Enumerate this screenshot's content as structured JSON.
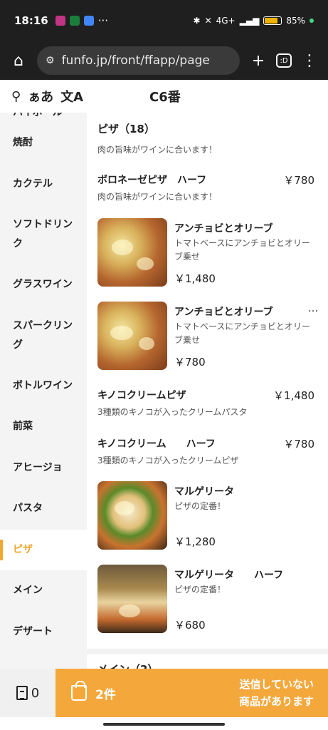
{
  "status_bar": {
    "time": "18:16",
    "network": "4G+",
    "battery": "85",
    "battery_fraction": 0.85,
    "app_colors": [
      "#c13584",
      "#1a7f3c",
      "#4285f4"
    ]
  },
  "browser": {
    "url": "funfo.jp/front/ffapp/page",
    "tab_label": ":D",
    "icons": [
      "home-icon",
      "site-settings-icon",
      "new-tab-icon",
      "tabs-icon",
      "menu-icon"
    ]
  },
  "header": {
    "font_size_label": "ぁあ",
    "table_label": "C6番"
  },
  "sidebar": {
    "items": [
      {
        "label": "ハイボール"
      },
      {
        "label": "焼酎"
      },
      {
        "label": "カクテル"
      },
      {
        "label": "ソフトドリンク"
      },
      {
        "label": "グラスワイン"
      },
      {
        "label": "スパークリング"
      },
      {
        "label": "ボトルワイン"
      },
      {
        "label": "前菜"
      },
      {
        "label": "アヒージョ"
      },
      {
        "label": "パスタ"
      },
      {
        "label": "ピザ"
      },
      {
        "label": "メイン"
      },
      {
        "label": "デザート"
      }
    ],
    "active": "ピザ"
  },
  "category": {
    "title": "ピザ（18）",
    "description": "肉の旨味がワインに合います！"
  },
  "menu_items": [
    {
      "name": "ボロネーゼピザ　ハーフ",
      "description": "肉の旨味がワインに合います！",
      "price": "￥780",
      "has_image": false
    },
    {
      "name": "アンチョビとオリーブ",
      "description": "トマトベースにアンチョビとオリーブ乗せ",
      "price": "￥1,480",
      "has_image": true
    },
    {
      "name": "アンチョビとオリーブ",
      "description": "トマトベースにアンチョビとオリーブ乗せ",
      "price": "￥780",
      "has_image": true,
      "more": "…"
    },
    {
      "name": "キノコクリームピザ",
      "description": "3種類のキノコが入ったクリームパスタ",
      "price": "￥1,480",
      "has_image": false
    },
    {
      "name": "キノコクリーム　　ハーフ",
      "description": "3種類のキノコが入ったクリームピザ",
      "price": "￥780",
      "has_image": false
    },
    {
      "name": "マルゲリータ",
      "description": "ピザの定番！",
      "price": "￥1,280",
      "has_image": true
    },
    {
      "name": "マルゲリータ　　ハーフ",
      "description": "ピザの定番！",
      "price": "￥680",
      "has_image": true
    }
  ],
  "next_category": {
    "title": "メイン（2）"
  },
  "bottom_bar": {
    "order_count": "0",
    "cart_count": "2件",
    "unsent_line1": "送信していない",
    "unsent_line2": "商品があります",
    "accent_color": "#f4a83c"
  }
}
